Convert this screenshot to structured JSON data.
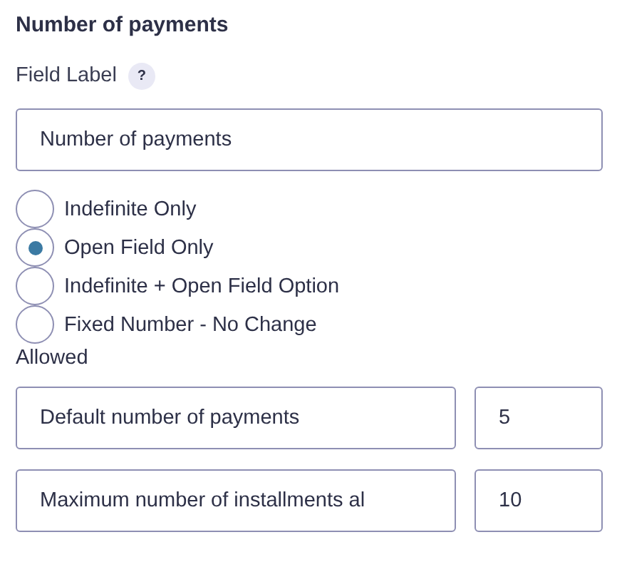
{
  "section_title": "Number of payments",
  "field_label": {
    "label": "Field Label",
    "help": "?",
    "value": "Number of payments"
  },
  "options": [
    {
      "label": "Indefinite Only",
      "selected": false
    },
    {
      "label": "Open Field Only",
      "selected": true
    },
    {
      "label": "Indefinite + Open Field Option",
      "selected": false
    },
    {
      "label": "Fixed Number - No Change",
      "selected": false
    }
  ],
  "allowed_label": "Allowed",
  "rows": [
    {
      "label": "Default number of payments",
      "value": "5"
    },
    {
      "label": "Maximum number of installments al",
      "value": "10"
    }
  ]
}
